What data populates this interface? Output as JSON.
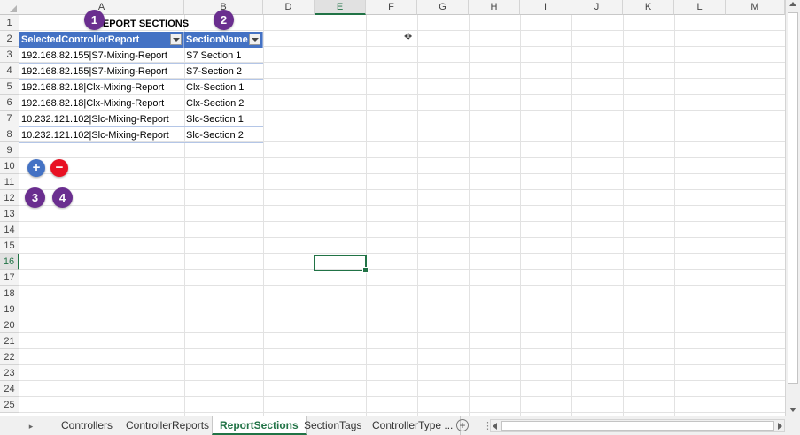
{
  "columns": [
    "A",
    "B",
    "D",
    "E",
    "F",
    "G",
    "H",
    "I",
    "J",
    "K",
    "L",
    "M"
  ],
  "rows": [
    "1",
    "2",
    "3",
    "4",
    "5",
    "6",
    "7",
    "8",
    "9",
    "10",
    "11",
    "12",
    "13",
    "14",
    "15",
    "16",
    "17",
    "18",
    "19",
    "20",
    "21",
    "22",
    "23",
    "24",
    "25"
  ],
  "active_cell": {
    "column": "E",
    "row": "16"
  },
  "title": "REPORT SECTIONS",
  "table": {
    "headers": [
      "SelectedControllerReport",
      "SectionName"
    ],
    "rows": [
      [
        "192.168.82.155|S7-Mixing-Report",
        "S7 Section 1"
      ],
      [
        "192.168.82.155|S7-Mixing-Report",
        "S7-Section 2"
      ],
      [
        "192.168.82.18|Clx-Mixing-Report",
        "Clx-Section 1"
      ],
      [
        "192.168.82.18|Clx-Mixing-Report",
        "Clx-Section 2"
      ],
      [
        "10.232.121.102|Slc-Mixing-Report",
        "Slc-Section 1"
      ],
      [
        "10.232.121.102|Slc-Mixing-Report",
        "Slc-Section 2"
      ]
    ]
  },
  "callouts": [
    "1",
    "2",
    "3",
    "4"
  ],
  "buttons": {
    "add": "+",
    "remove": "−"
  },
  "tabs": [
    "Controllers",
    "ControllerReports",
    "ReportSections",
    "SectionTags",
    "ControllerType ..."
  ],
  "active_tab": "ReportSections",
  "tab_bar": {
    "add_sheet": "+",
    "separator": "⋮",
    "nav_right": "▸"
  },
  "colors": {
    "table_header": "#4472c4",
    "accent": "#217346",
    "callout": "#6a2e8f",
    "add_button": "#4472c4",
    "remove_button": "#e81123"
  }
}
